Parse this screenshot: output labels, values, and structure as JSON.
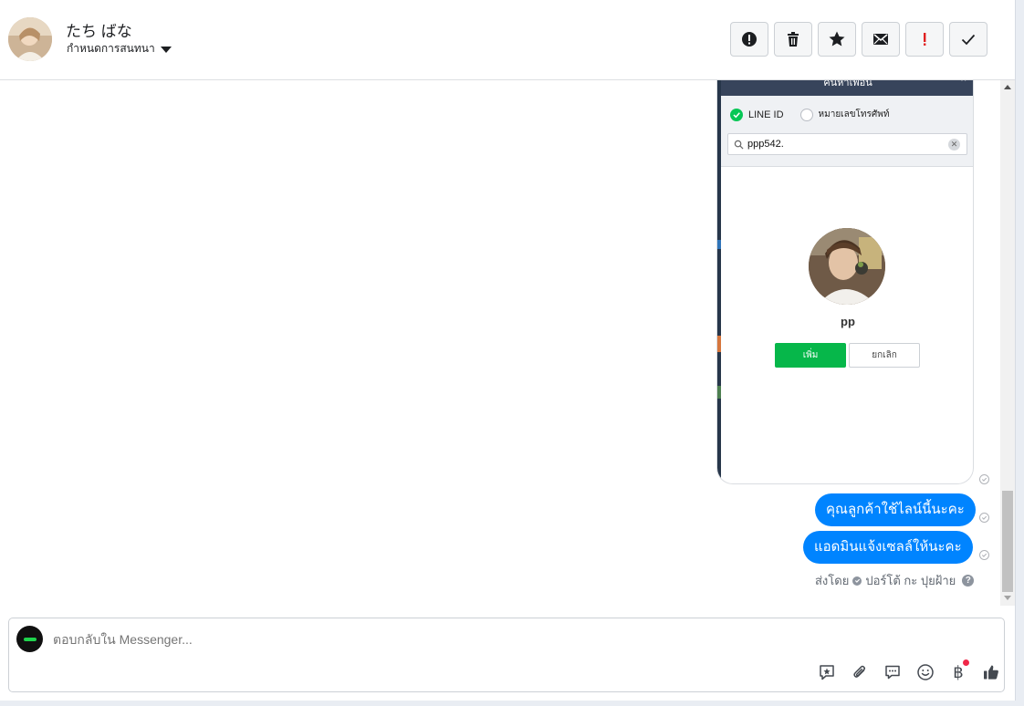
{
  "header": {
    "contact_name": "たち ばな",
    "assign_label": "กำหนดการสนทนา",
    "toolbar": [
      {
        "name": "report-spam-button",
        "icon": "alert-circle-icon"
      },
      {
        "name": "delete-button",
        "icon": "trash-icon"
      },
      {
        "name": "star-button",
        "icon": "star-icon"
      },
      {
        "name": "mark-unread-button",
        "icon": "envelope-icon"
      },
      {
        "name": "mark-important-button",
        "icon": "exclamation-icon"
      },
      {
        "name": "mark-done-button",
        "icon": "check-icon"
      }
    ]
  },
  "attachment": {
    "titlebar": "ค้นหาเพื่อน",
    "close": "×",
    "option_line_id": "LINE ID",
    "option_phone": "หมายเลขโทรศัพท์",
    "search_value": "ppp542.",
    "profile_name": "pp",
    "add_label": "เพิ่ม",
    "cancel_label": "ยกเลิก"
  },
  "messages": [
    {
      "text": "คุณลูกค้าใช้ไลน์นี้นะคะ"
    },
    {
      "text": "แอดมินแจ้งเซลล์ให้นะคะ"
    }
  ],
  "sent_by": {
    "prefix": "ส่งโดย",
    "name": "ปอร์โต้ กะ ปุยฝ้าย",
    "help": "?"
  },
  "composer": {
    "placeholder": "ตอบกลับใน Messenger...",
    "tools": [
      "saved-reply-icon",
      "attachment-icon",
      "chat-bubble-icon",
      "emoji-icon",
      "baht-payment-icon",
      "thumbs-up-icon"
    ],
    "baht_symbol": "฿"
  },
  "colors": {
    "bubble": "#0084ff",
    "line_green": "#06c755",
    "important_red": "#e02020"
  }
}
